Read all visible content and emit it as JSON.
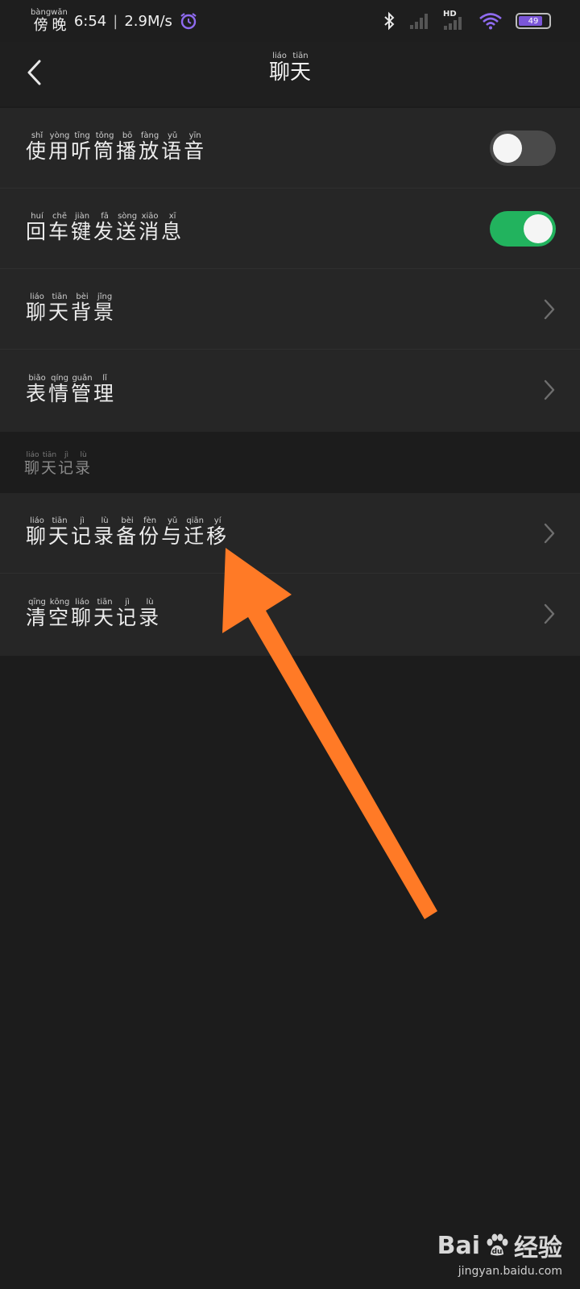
{
  "status_bar": {
    "time_pinyin": [
      "bàng",
      "wǎn"
    ],
    "time_chars": [
      "傍",
      "晚"
    ],
    "time": "6:54",
    "speed": "2.9M/s",
    "hd": "HD",
    "battery": "49"
  },
  "header": {
    "title_chars": [
      "聊",
      "天"
    ],
    "title_pinyin": [
      "liáo",
      "tiān"
    ]
  },
  "settings": [
    {
      "chars": [
        "使",
        "用",
        "听",
        "筒",
        "播",
        "放",
        "语",
        "音"
      ],
      "pinyin": [
        "shǐ",
        "yòng",
        "tīng",
        "tǒng",
        "bō",
        "fàng",
        "yǔ",
        "yīn"
      ],
      "control": "toggle",
      "state": "off"
    },
    {
      "chars": [
        "回",
        "车",
        "键",
        "发",
        "送",
        "消",
        "息"
      ],
      "pinyin": [
        "huí",
        "chē",
        "jiàn",
        "fā",
        "sòng",
        "xiāo",
        "xī"
      ],
      "control": "toggle",
      "state": "on"
    },
    {
      "chars": [
        "聊",
        "天",
        "背",
        "景"
      ],
      "pinyin": [
        "liáo",
        "tiān",
        "bèi",
        "jǐng"
      ],
      "control": "chevron"
    },
    {
      "chars": [
        "表",
        "情",
        "管",
        "理"
      ],
      "pinyin": [
        "biǎo",
        "qíng",
        "guǎn",
        "lǐ"
      ],
      "control": "chevron"
    }
  ],
  "section": {
    "chars": [
      "聊",
      "天",
      "记",
      "录"
    ],
    "pinyin": [
      "liáo",
      "tiān",
      "jì",
      "lù"
    ]
  },
  "records": [
    {
      "chars": [
        "聊",
        "天",
        "记",
        "录",
        "备",
        "份",
        "与",
        "迁",
        "移"
      ],
      "pinyin": [
        "liáo",
        "tiān",
        "jì",
        "lù",
        "bèi",
        "fèn",
        "yǔ",
        "qiān",
        "yí"
      ],
      "control": "chevron"
    },
    {
      "chars": [
        "清",
        "空",
        "聊",
        "天",
        "记",
        "录"
      ],
      "pinyin": [
        "qīng",
        "kōng",
        "liáo",
        "tiān",
        "jì",
        "lù"
      ],
      "control": "chevron"
    }
  ],
  "watermark": {
    "brand_a": "Bai",
    "brand_b": "经验",
    "site": "jingyan.baidu.com"
  },
  "colors": {
    "toggle_on": "#22b35e",
    "toggle_off": "#4a4a4a",
    "arrow": "#ff7a26",
    "battery": "#7b56d8"
  }
}
